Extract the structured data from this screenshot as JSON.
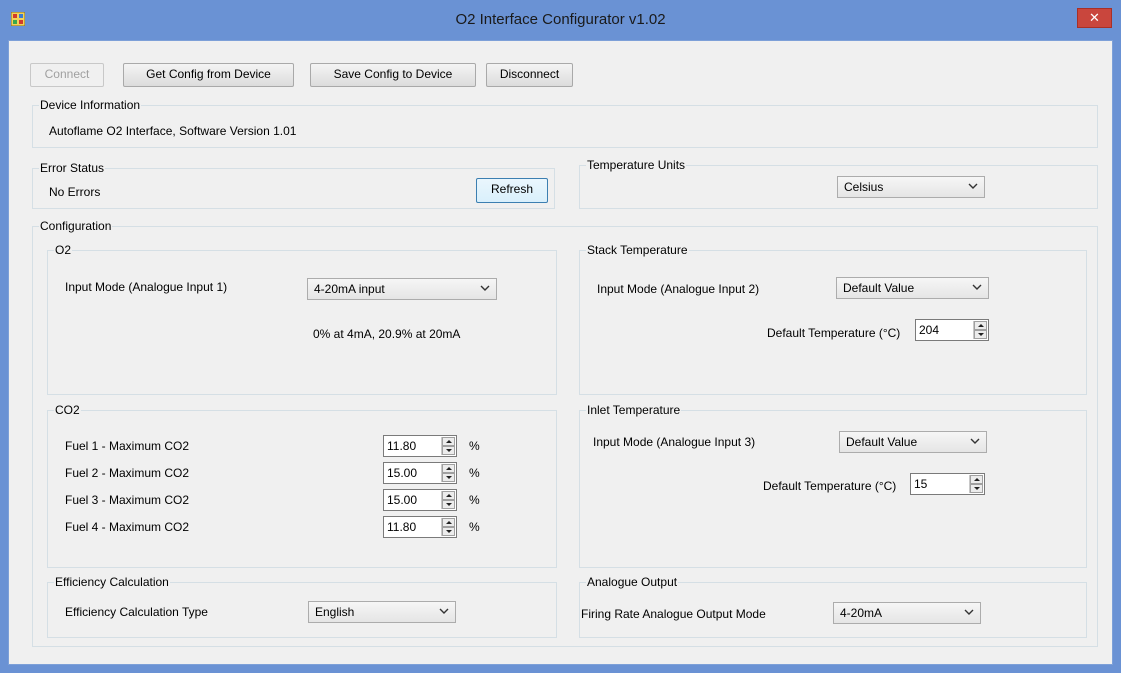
{
  "window": {
    "title": "O2 Interface Configurator v1.02",
    "close_label": "✕"
  },
  "toolbar": {
    "connect_label": "Connect",
    "get_config_label": "Get Config from Device",
    "save_config_label": "Save Config to Device",
    "disconnect_label": "Disconnect"
  },
  "device_info": {
    "title": "Device Information",
    "text": "Autoflame O2 Interface, Software Version 1.01"
  },
  "error_status": {
    "title": "Error Status",
    "text": "No Errors",
    "refresh_label": "Refresh"
  },
  "temperature_units": {
    "title": "Temperature Units",
    "selected": "Celsius"
  },
  "configuration": {
    "title": "Configuration",
    "o2": {
      "title": "O2",
      "input_mode_label": "Input Mode (Analogue Input 1)",
      "input_mode_selected": "4-20mA input",
      "note": "0% at 4mA, 20.9% at 20mA"
    },
    "stack_temperature": {
      "title": "Stack Temperature",
      "input_mode_label": "Input Mode (Analogue Input 2)",
      "input_mode_selected": "Default Value",
      "default_temp_label": "Default Temperature (°C)",
      "default_temp_value": "204"
    },
    "co2": {
      "title": "CO2",
      "rows": [
        {
          "label": "Fuel 1 - Maximum CO2",
          "value": "11.80",
          "unit": "%"
        },
        {
          "label": "Fuel 2 - Maximum CO2",
          "value": "15.00",
          "unit": "%"
        },
        {
          "label": "Fuel 3 - Maximum CO2",
          "value": "15.00",
          "unit": "%"
        },
        {
          "label": "Fuel 4 - Maximum CO2",
          "value": "11.80",
          "unit": "%"
        }
      ]
    },
    "inlet_temperature": {
      "title": "Inlet Temperature",
      "input_mode_label": "Input Mode (Analogue Input 3)",
      "input_mode_selected": "Default Value",
      "default_temp_label": "Default Temperature (°C)",
      "default_temp_value": "15"
    },
    "efficiency": {
      "title": "Efficiency Calculation",
      "type_label": "Efficiency Calculation Type",
      "type_selected": "English"
    },
    "analogue_output": {
      "title": "Analogue Output",
      "mode_label": "Firing Rate Analogue Output Mode",
      "mode_selected": "4-20mA"
    }
  },
  "colors": {
    "titlebar": "#6a92d4",
    "client_bg": "#f0f0f0",
    "close_button": "#c9463d"
  }
}
